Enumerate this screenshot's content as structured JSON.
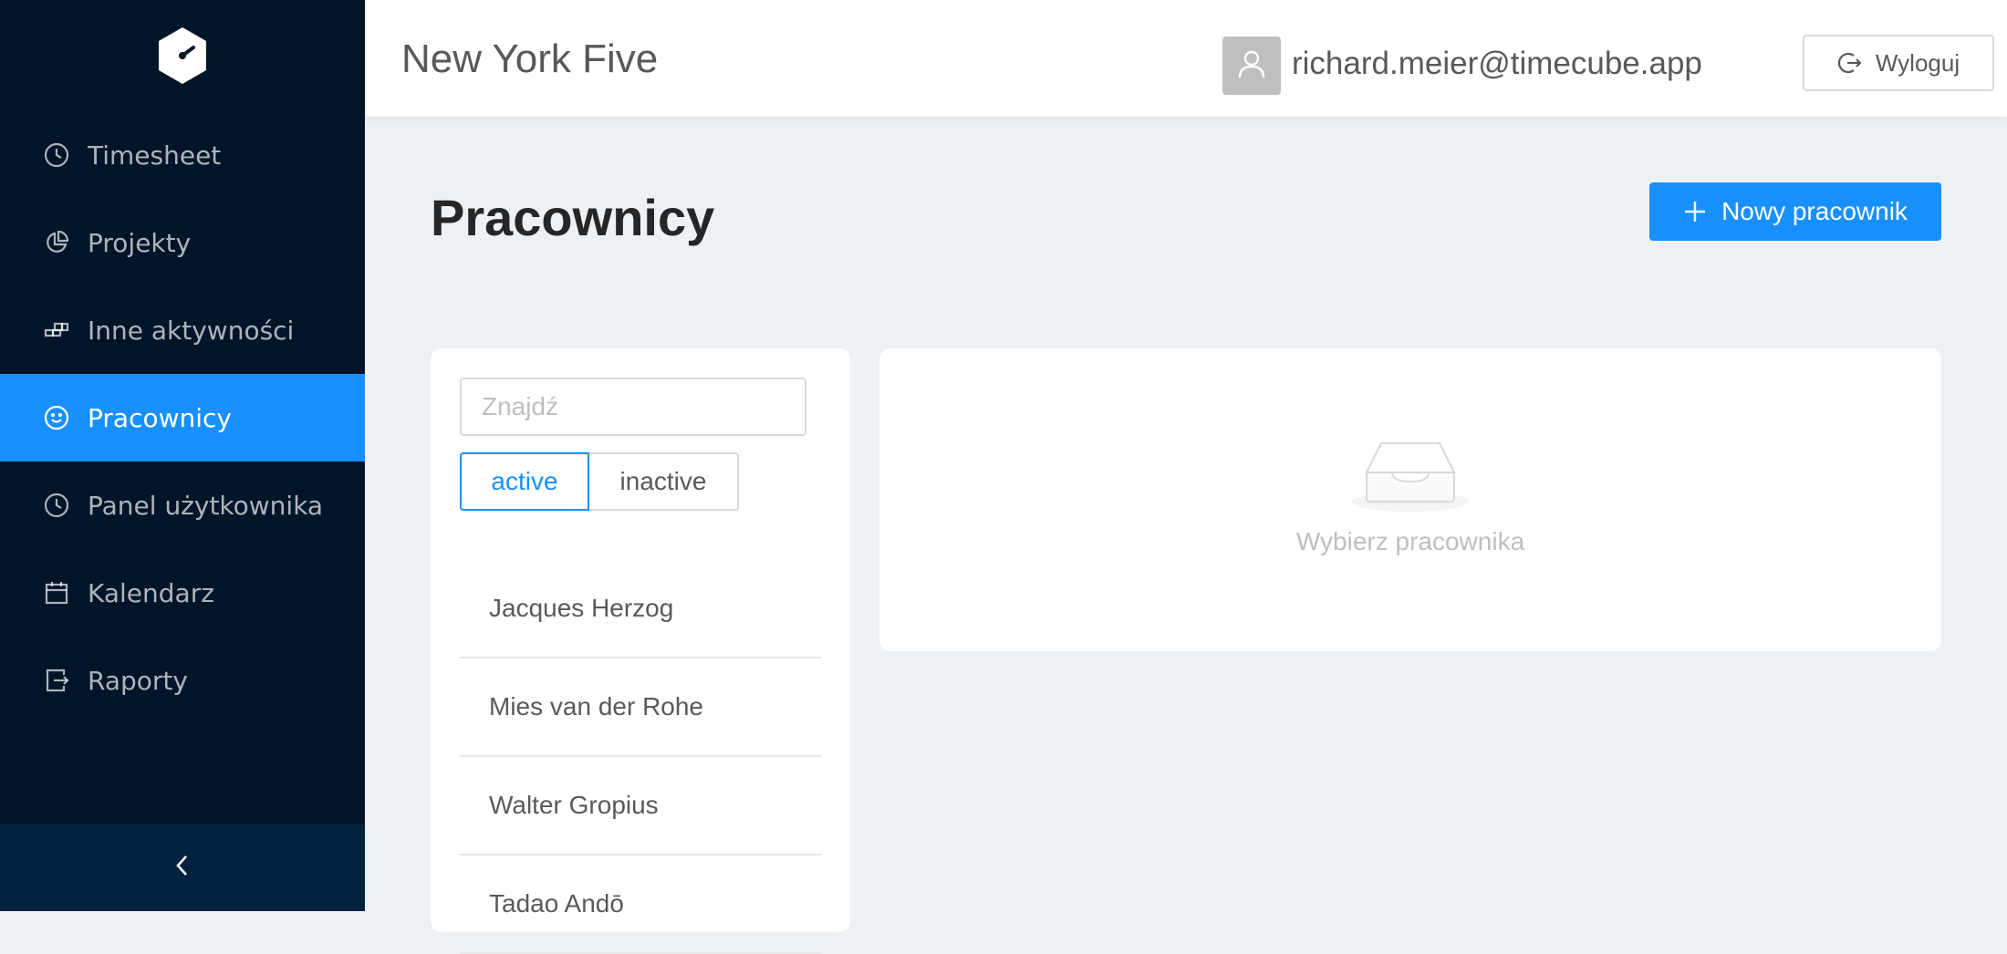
{
  "sidebar": {
    "items": [
      {
        "label": "Timesheet",
        "icon": "clock-icon"
      },
      {
        "label": "Projekty",
        "icon": "pie-chart-icon"
      },
      {
        "label": "Inne aktywności",
        "icon": "build-icon"
      },
      {
        "label": "Pracownicy",
        "icon": "smile-icon",
        "active": true
      },
      {
        "label": "Panel użytkownika",
        "icon": "clock-icon"
      },
      {
        "label": "Kalendarz",
        "icon": "calendar-icon"
      },
      {
        "label": "Raporty",
        "icon": "export-icon"
      }
    ],
    "collapse_icon": "chevron-left-icon"
  },
  "header": {
    "org_title": "New York Five",
    "user_email": "richard.meier@timecube.app",
    "logout_label": "Wyloguj"
  },
  "main": {
    "title": "Pracownicy",
    "new_button_label": "Nowy pracownik",
    "search": {
      "placeholder": "Znajdź",
      "value": ""
    },
    "filter": {
      "active_label": "active",
      "inactive_label": "inactive",
      "selected": "active"
    },
    "employees": [
      "Jacques Herzog",
      "Mies van der Rohe",
      "Walter Gropius",
      "Tadao Andō"
    ],
    "empty_state_text": "Wybierz pracownika"
  },
  "colors": {
    "primary": "#1890ff",
    "sidebar_bg": "#011529"
  }
}
